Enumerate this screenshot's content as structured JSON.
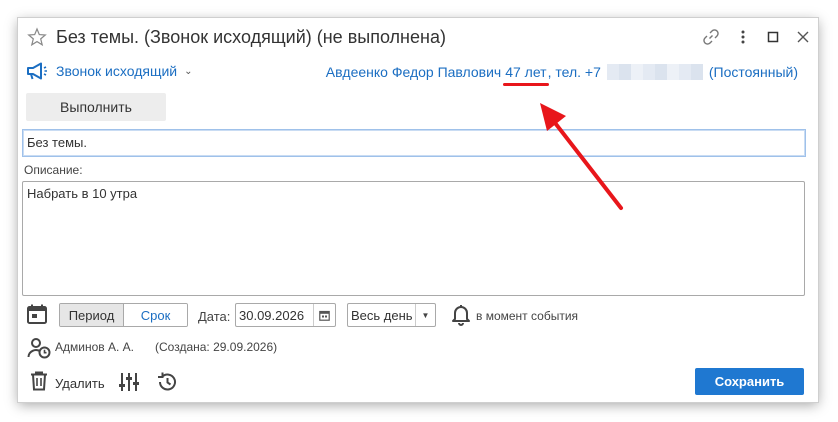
{
  "window": {
    "title": "Без темы. (Звонок исходящий) (не выполнена)"
  },
  "call": {
    "type_label": "Звонок исходящий",
    "contact_name": "Авдеенко Федор Павлович",
    "age": "47 лет",
    "phone_prefix": ", тел. +7",
    "contact_status": "(Постоянный)"
  },
  "actions": {
    "execute_label": "Выполнить",
    "delete_label": "Удалить",
    "save_label": "Сохранить"
  },
  "form": {
    "subject_value": "Без темы.",
    "description_label": "Описание:",
    "description_value": "Набрать в 10 утра",
    "period_label": "Период",
    "deadline_label": "Срок",
    "date_label": "Дата:",
    "date_value": "30.09.2026",
    "allday_value": "Весь день",
    "reminder_label": "в момент события"
  },
  "meta": {
    "author": "Админов А. А.",
    "created": "(Создана: 29.09.2026)"
  },
  "colors": {
    "accent": "#1f78d1",
    "link": "#1b6ec2",
    "annotation": "#e8161b"
  },
  "icons": [
    "star-icon",
    "link-icon",
    "more-icon",
    "maximize-icon",
    "close-icon",
    "megaphone-icon",
    "calendar-icon",
    "calendar-small-icon",
    "bell-icon",
    "user-clock-icon",
    "trash-icon",
    "settings-sliders-icon",
    "history-icon"
  ]
}
